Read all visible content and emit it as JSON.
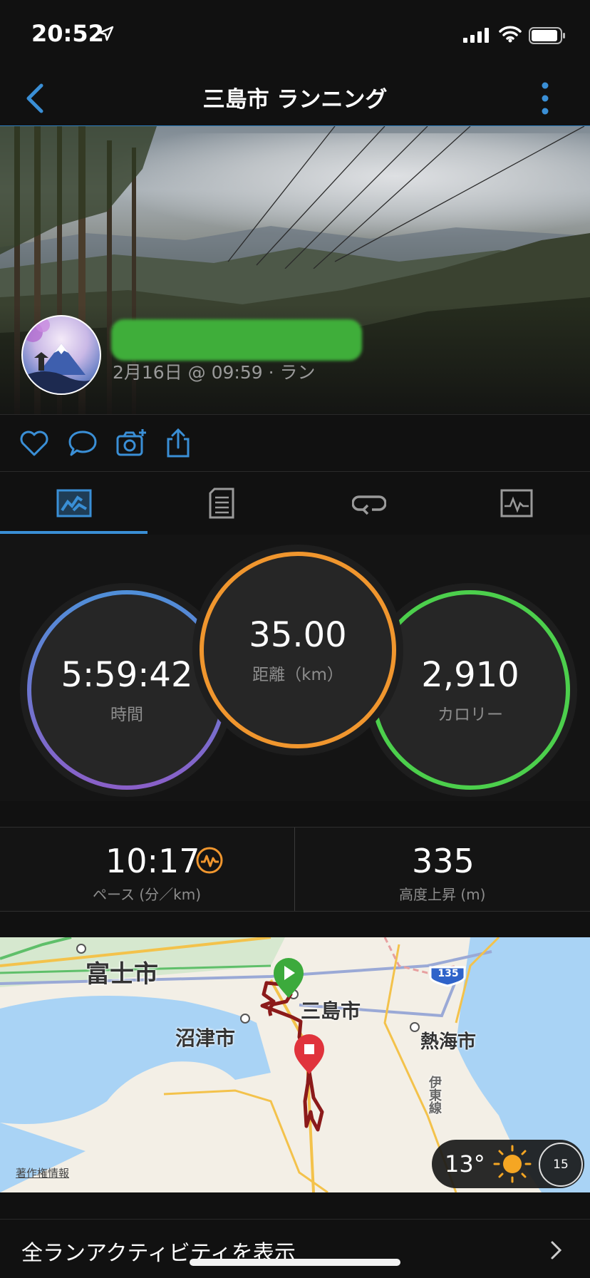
{
  "status_bar": {
    "time": "20:52"
  },
  "nav": {
    "title": "三島市 ランニング"
  },
  "activity": {
    "subtitle": "2月16日 @ 09:59 · ラン"
  },
  "tabs": [
    {
      "name": "summary",
      "icon": "summary-chart-icon",
      "selected": true
    },
    {
      "name": "details",
      "icon": "document-list-icon",
      "selected": false
    },
    {
      "name": "laps",
      "icon": "loop-arrow-icon",
      "selected": false
    },
    {
      "name": "charts",
      "icon": "waveform-chart-icon",
      "selected": false
    }
  ],
  "rings": {
    "time": {
      "value": "5:59:42",
      "label": "時間",
      "color": "#4f8fd8"
    },
    "distance": {
      "value": "35.00",
      "label": "距離（km）",
      "color": "#f0962e"
    },
    "calories": {
      "value": "2,910",
      "label": "カロリー",
      "color": "#4ccf4c"
    }
  },
  "stats": {
    "pace": {
      "value": "10:17",
      "label": "ペース (分／km)"
    },
    "elevation": {
      "value": "335",
      "label": "高度上昇 (m)"
    }
  },
  "map": {
    "labels": {
      "fuji": "富士市",
      "mishima": "三島市",
      "numazu": "沼津市",
      "atami": "熱海市",
      "itou_line": "伊東線"
    },
    "route_badge": "135",
    "copyright": "著作権情報",
    "weather": {
      "temperature": "13°",
      "wind": "15"
    }
  },
  "footer": {
    "all_runs": "全ランアクティビティを表示"
  },
  "colors": {
    "accent": "#3a8fd6",
    "route": "#8b1a1a",
    "start": "#3caa3c",
    "end": "#e0333c"
  }
}
